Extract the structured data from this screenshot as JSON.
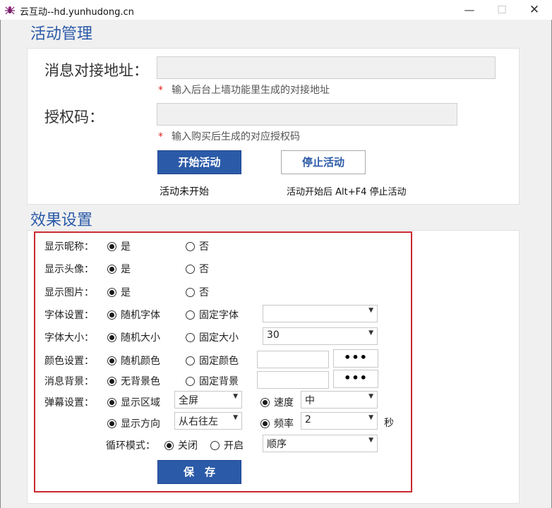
{
  "window": {
    "title": "云互动--hd.yunhudong.cn",
    "minimize": "—",
    "maximize": "☐",
    "close": "✕"
  },
  "activity": {
    "section_title": "活动管理",
    "message_url_label": "消息对接地址：",
    "message_url_value": "",
    "message_url_hint_star": "*",
    "message_url_hint": "输入后台上墙功能里生成的对接地址",
    "auth_code_label": "授权码：",
    "auth_code_value": "",
    "auth_code_hint_star": "*",
    "auth_code_hint": "输入购买后生成的对应授权码",
    "start_button": "开始活动",
    "stop_button": "停止活动",
    "status_text": "活动未开始",
    "stop_tip": "活动开始后  Alt+F4 停止活动"
  },
  "effects": {
    "section_title": "效果设置",
    "show_nickname": {
      "label": "显示昵称：",
      "opt_yes": "是",
      "opt_no": "否",
      "selected": "是"
    },
    "show_avatar": {
      "label": "显示头像：",
      "opt_yes": "是",
      "opt_no": "否",
      "selected": "是"
    },
    "show_image": {
      "label": "显示图片：",
      "opt_yes": "是",
      "opt_no": "否",
      "selected": "是"
    },
    "font": {
      "label": "字体设置：",
      "opt_random": "随机字体",
      "opt_fixed": "固定字体",
      "selected": "随机字体",
      "select_value": ""
    },
    "font_size": {
      "label": "字体大小：",
      "opt_random": "随机大小",
      "opt_fixed": "固定大小",
      "selected": "随机大小",
      "select_value": "30"
    },
    "color": {
      "label": "颜色设置：",
      "opt_random": "随机颜色",
      "opt_fixed": "固定颜色",
      "selected": "随机颜色",
      "picker_label": "•••"
    },
    "background": {
      "label": "消息背景：",
      "opt_none": "无背景色",
      "opt_fixed": "固定背景",
      "selected": "无背景色",
      "picker_label": "•••"
    },
    "danmaku": {
      "label": "弹幕设置：",
      "area_label": "显示区域",
      "area_value": "全屏",
      "speed_label": "速度",
      "speed_value": "中",
      "direction_label": "显示方向",
      "direction_value": "从右往左",
      "freq_label": "频率",
      "freq_value": "2",
      "freq_unit": "秒"
    },
    "loop": {
      "label": "循环模式：",
      "opt_off": "关闭",
      "opt_on": "开启",
      "selected": "关闭",
      "order_value": "顺序"
    },
    "save_button": "保　存"
  },
  "icons": {
    "app": "spider-icon",
    "dropdown": "chevron-down-icon"
  },
  "colors": {
    "accent": "#2b5aa8",
    "highlight_border": "#c8282f",
    "hint_star": "#e02020"
  }
}
